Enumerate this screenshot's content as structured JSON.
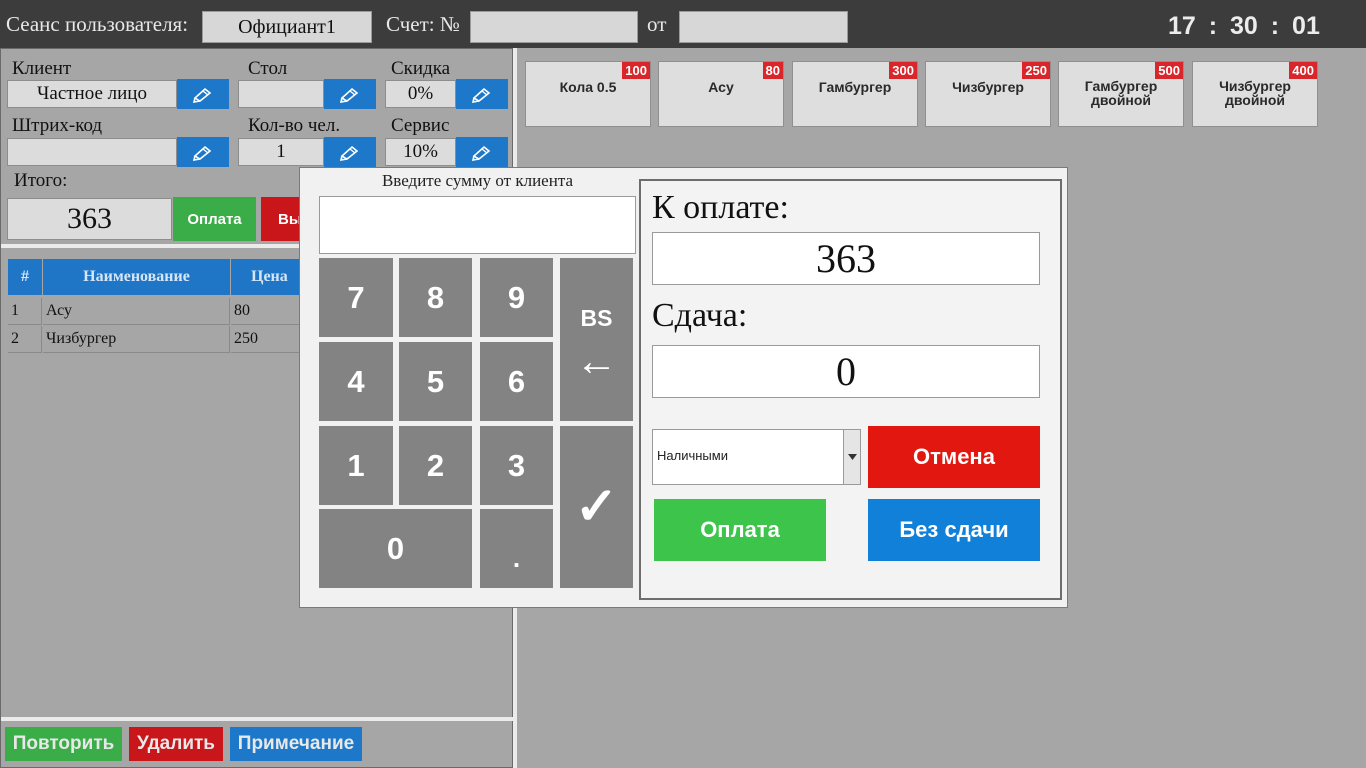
{
  "header": {
    "session_label": "Сеанс пользователя:",
    "session_user": "Официант1",
    "invoice_label": "Счет: №",
    "invoice_number": "",
    "from_label": "от",
    "invoice_date": "",
    "clock": "17 : 30 : 01"
  },
  "order": {
    "client_label": "Клиент",
    "client_value": "Частное лицо",
    "table_label": "Стол",
    "table_value": "",
    "discount_label": "Скидка",
    "discount_value": "0%",
    "barcode_label": "Штрих-код",
    "barcode_value": "",
    "guests_label": "Кол-во чел.",
    "guests_value": "1",
    "service_label": "Сервис",
    "service_value": "10%",
    "total_label": "Итого:",
    "total_value": "363",
    "pay_label": "Оплата",
    "exit_label": "Вы"
  },
  "grid": {
    "columns": [
      "#",
      "Наименование",
      "Цена"
    ],
    "rows": [
      {
        "num": "1",
        "name": "Асу",
        "price": "80"
      },
      {
        "num": "2",
        "name": "Чизбургер",
        "price": "250"
      }
    ]
  },
  "bottom_actions": {
    "repeat": "Повторить",
    "delete": "Удалить",
    "note": "Примечание"
  },
  "products": [
    {
      "name": "Кола 0.5",
      "price": "100"
    },
    {
      "name": "Асу",
      "price": "80"
    },
    {
      "name": "Гамбургер",
      "price": "300"
    },
    {
      "name": "Чизбургер",
      "price": "250"
    },
    {
      "name": "Гамбургер двойной",
      "price": "500"
    },
    {
      "name": "Чизбургер двойной",
      "price": "400"
    }
  ],
  "payment_dialog": {
    "prompt": "Введите сумму от клиента",
    "amount_entered": "",
    "keys": {
      "k7": "7",
      "k8": "8",
      "k9": "9",
      "k4": "4",
      "k5": "5",
      "k6": "6",
      "k1": "1",
      "k2": "2",
      "k3": "3",
      "k0": "0",
      "dot": ".",
      "backspace": "BS",
      "backspace_arrow": "←",
      "confirm": "✓"
    },
    "to_pay_label": "К оплате:",
    "to_pay_value": "363",
    "change_label": "Сдача:",
    "change_value": "0",
    "payment_method": "Наличными",
    "cancel_label": "Отмена",
    "pay_label": "Оплата",
    "no_change_label": "Без сдачи"
  },
  "colors": {
    "blue": "#1d78c9",
    "green": "#3bbf49",
    "red": "#e2170f",
    "key_gray": "#838383"
  }
}
